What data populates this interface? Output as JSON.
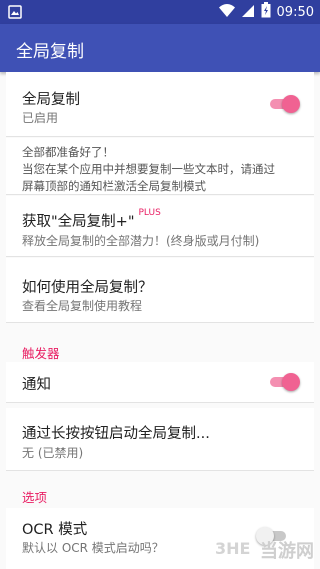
{
  "status_bar": {
    "time": "09:50"
  },
  "app_bar": {
    "title": "全局复制"
  },
  "items": {
    "global_copy": {
      "title": "全局复制",
      "subtitle": "已启用",
      "enabled": true
    },
    "ready_message": {
      "line1": "全部都准备好了！",
      "line2": "当您在某个应用中并想要复制一些文本时，请通过",
      "line3": "屏幕顶部的通知栏激活全局复制模式"
    },
    "get_plus": {
      "title": "获取\"全局复制+\"",
      "badge": "PLUS",
      "subtitle": "释放全局复制的全部潜力！(终身版或月付制)"
    },
    "how_to": {
      "title": "如何使用全局复制？",
      "subtitle": "查看全局复制使用教程"
    }
  },
  "sections": {
    "trigger": {
      "header": "触发器",
      "notification": {
        "title": "通知",
        "enabled": true
      },
      "long_press": {
        "title": "通过长按按钮启动全局复制...",
        "subtitle": "无 (已禁用)"
      }
    },
    "options": {
      "header": "选项",
      "ocr": {
        "title": "OCR 模式",
        "subtitle": "默认以 OCR 模式启动吗？",
        "enabled": false
      }
    }
  },
  "watermark": {
    "text": "当游网"
  },
  "colors": {
    "primary": "#3f51b5",
    "primary_dark": "#303f9f",
    "accent": "#e91e63"
  }
}
